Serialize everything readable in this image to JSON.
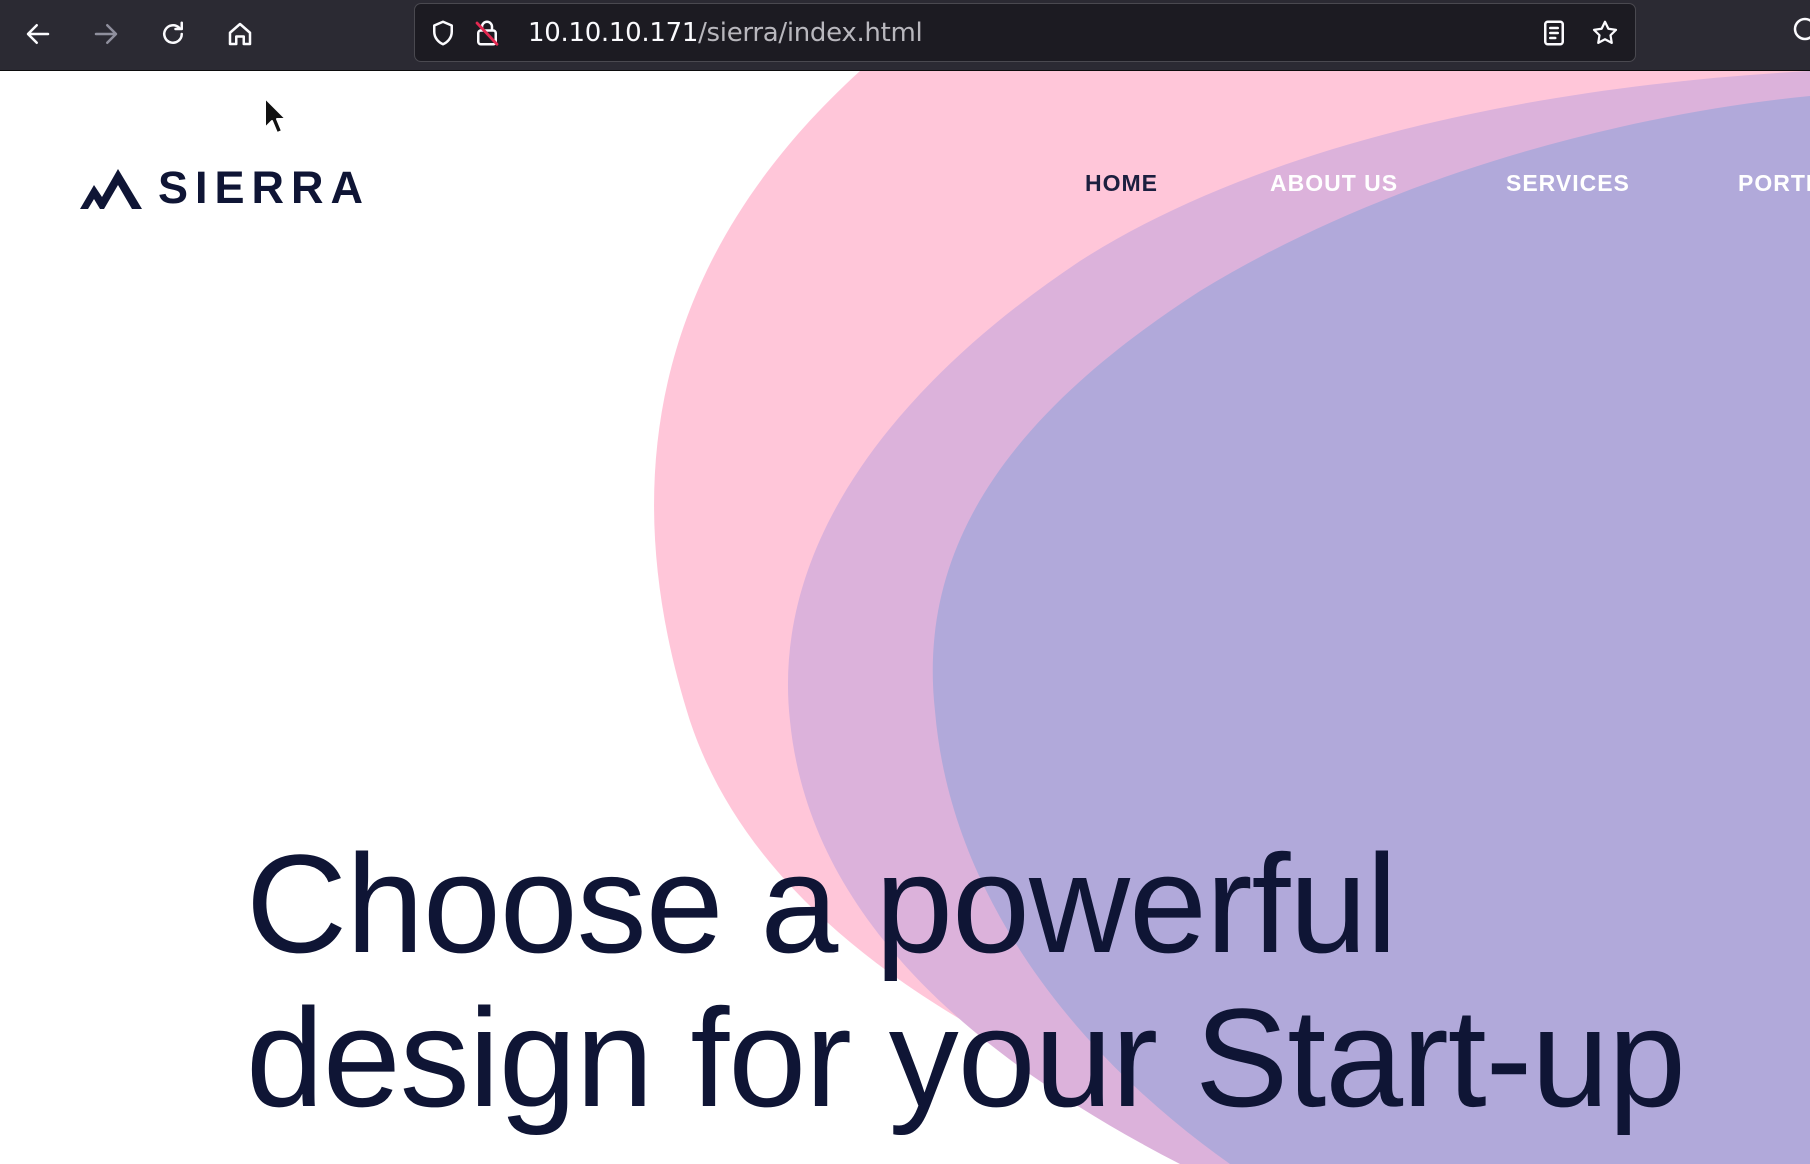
{
  "browser": {
    "url_host": "10.10.10.171",
    "url_path": "/sierra/index.html",
    "icons": [
      "back-icon",
      "forward-icon",
      "reload-icon",
      "home-icon",
      "shield-icon",
      "insecure-lock-icon",
      "reader-mode-icon",
      "bookmark-star-icon",
      "extension-icon"
    ]
  },
  "site": {
    "logo_text": "SIERRA",
    "nav": {
      "home": "HOME",
      "about": "ABOUT US",
      "services": "SERVICES",
      "portfolio": "PORTI"
    },
    "hero": {
      "line1": "Choose a powerful",
      "line2": "design for your Start-up"
    }
  },
  "colors": {
    "chrome_bg": "#2b2a33",
    "url_bg": "#1c1b22",
    "text_dark": "#0f1535",
    "blob_pink": "#ffc6d9",
    "blob_mauve": "#dcb2db",
    "blob_lavender": "#b1a9da"
  }
}
